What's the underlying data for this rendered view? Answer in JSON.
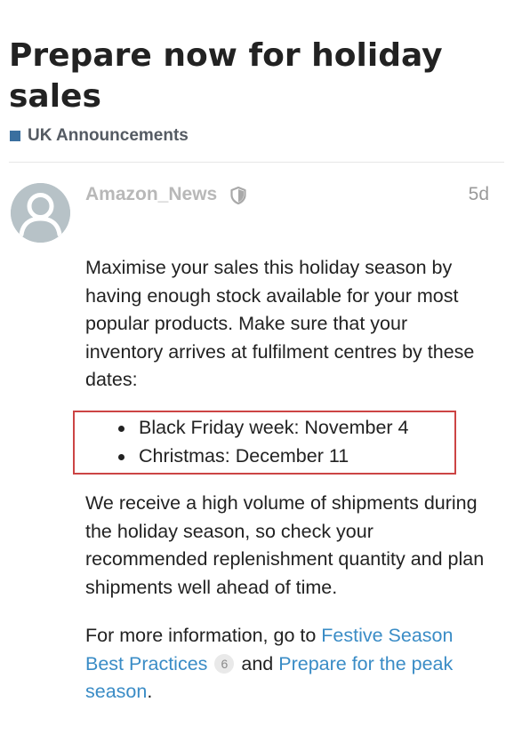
{
  "topic": {
    "title": "Prepare now for holiday sales",
    "category": {
      "label": "UK Announcements",
      "color": "#3a6f9f"
    }
  },
  "post": {
    "author": {
      "username": "Amazon_News",
      "avatar_icon": "default-user-avatar",
      "badge_icon": "shield-icon"
    },
    "date": "5d",
    "paragraph1": "Maximise your sales this holiday season by having enough stock available for your most popular products. Make sure that your inventory arrives at fulfilment centres by these dates:",
    "dates": [
      "Black Friday week: November 4",
      "Christmas: December 11"
    ],
    "highlight_color": "#cc4444",
    "paragraph2": "We receive a high volume of shipments during the holiday season, so check your recommended replenishment quantity and plan shipments well ahead of time.",
    "paragraph3": {
      "prefix": "For more information, go to ",
      "link1": "Festive Season Best Practices",
      "link1_clicks": "6",
      "middle": " and ",
      "link2": "Prepare for the peak season",
      "suffix": "."
    },
    "link_color": "#3a8cc6"
  }
}
